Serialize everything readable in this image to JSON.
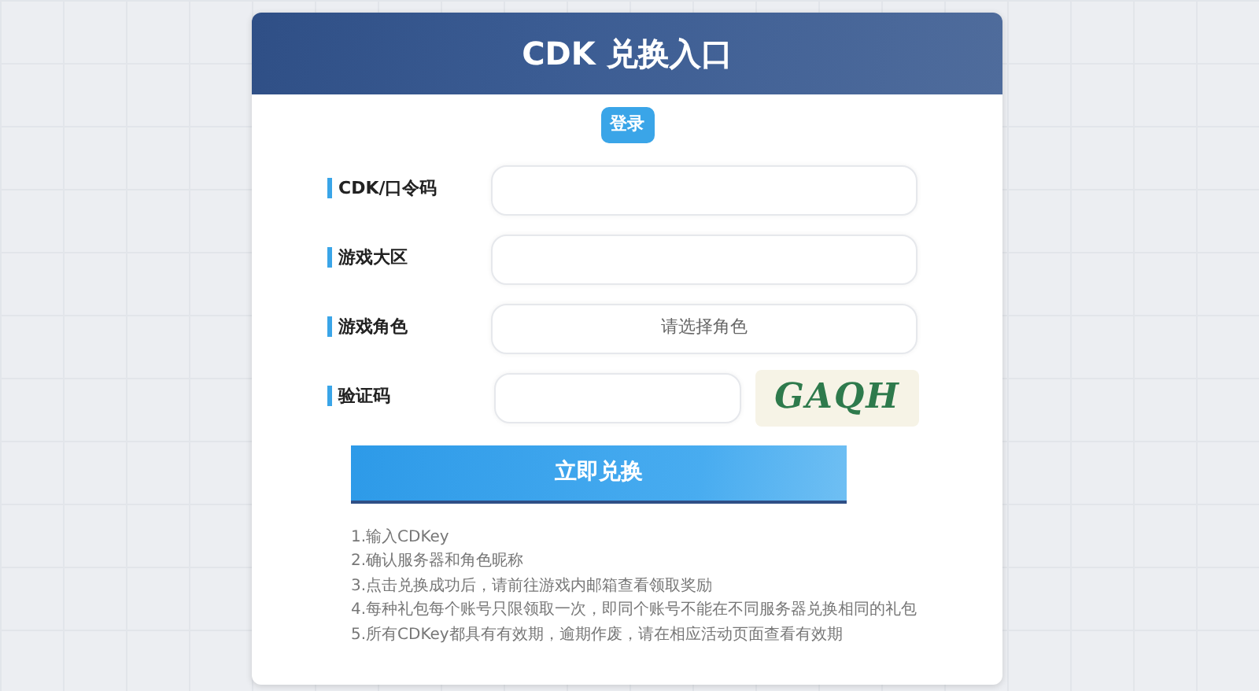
{
  "header": {
    "title": "CDK 兑换入口"
  },
  "login_button": "登录",
  "fields": [
    {
      "label": "CDK/口令码",
      "kind": "input"
    },
    {
      "label": "游戏大区",
      "kind": "input"
    },
    {
      "label": "游戏角色",
      "kind": "select",
      "placeholder": "请选择角色"
    },
    {
      "label": "验证码",
      "kind": "captcha",
      "captcha": "GAQH"
    }
  ],
  "submit_button": "立即兑换",
  "instructions": [
    "1.输入CDKey",
    "2.确认服务器和角色昵称",
    "3.点击兑换成功后，请前往游戏内邮箱查看领取奖励",
    "4.每种礼包每个账号只限领取一次，即同个账号不能在不同服务器兑换相同的礼包",
    "5.所有CDKey都具有有效期，逾期作废，请在相应活动页面查看有效期"
  ]
}
